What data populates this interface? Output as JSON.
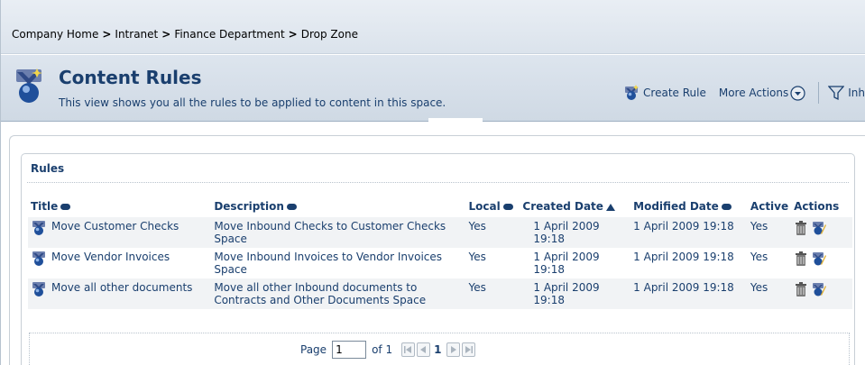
{
  "breadcrumb": {
    "items": [
      "Company Home",
      "Intranet",
      "Finance Department",
      "Drop Zone"
    ],
    "separator": ">"
  },
  "header": {
    "title": "Content Rules",
    "subtitle": "This view shows you all the rules to be applied to content in this space.",
    "actions": {
      "create_rule": "Create Rule",
      "more_actions": "More Actions",
      "inherit": "Inh"
    }
  },
  "rules_panel": {
    "title": "Rules",
    "columns": {
      "title": "Title",
      "description": "Description",
      "local": "Local",
      "created": "Created Date",
      "modified": "Modified Date",
      "active": "Active",
      "actions": "Actions"
    },
    "rows": [
      {
        "title": "Move Customer Checks",
        "description": "Move Inbound Checks to Customer Checks Space",
        "local": "Yes",
        "created": "1 April 2009 19:18",
        "modified": "1 April 2009 19:18",
        "active": "Yes"
      },
      {
        "title": "Move Vendor Invoices",
        "description": "Move Inbound Invoices to Vendor Invoices Space",
        "local": "Yes",
        "created": "1 April 2009 19:18",
        "modified": "1 April 2009 19:18",
        "active": "Yes"
      },
      {
        "title": "Move all other documents",
        "description": "Move all other Inbound documents to Contracts and Other Documents Space",
        "local": "Yes",
        "created": "1 April 2009 19:18",
        "modified": "1 April 2009 19:18",
        "active": "Yes"
      }
    ]
  },
  "pager": {
    "page_label": "Page",
    "page_value": "1",
    "of_label": "of 1",
    "current_page": "1"
  },
  "colors": {
    "accent": "#1a3f6e",
    "header_bg": "#cfd9e4",
    "alt_row": "#f1f3f5"
  },
  "icons": {
    "header": "rules-wizard-icon",
    "create_rule": "create-rule-icon",
    "more_actions": "chevron-down-circle-icon",
    "inherit": "filter-icon",
    "row": "rule-icon",
    "delete": "trash-icon",
    "edit": "edit-rule-icon"
  }
}
